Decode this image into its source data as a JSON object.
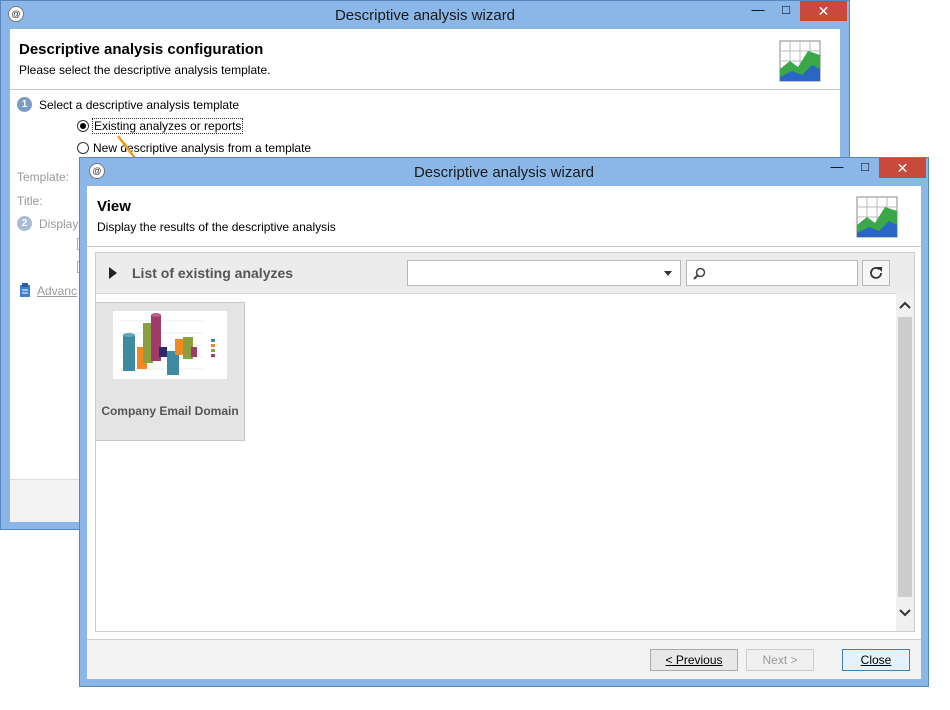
{
  "back_window": {
    "title": "Descriptive analysis wizard",
    "header_title": "Descriptive analysis configuration",
    "header_subtitle": "Please select the descriptive analysis template.",
    "step1_number": "1",
    "step1_label": "Select a descriptive analysis template",
    "option_existing": "Existing analyzes or reports",
    "option_new": "New descriptive analysis from a template",
    "template_label": "Template:",
    "title_label": "Title:",
    "step2_number": "2",
    "step2_label": "Display",
    "advanced_link": "Advanc"
  },
  "front_window": {
    "title": "Descriptive analysis wizard",
    "header_title": "View",
    "header_subtitle": "Display the results of the descriptive analysis",
    "list_title": "List of existing analyzes",
    "dropdown_value": "",
    "search_value": "",
    "items": [
      {
        "label": "Company Email Domain"
      }
    ],
    "prev_button": "< Previous",
    "next_button": "Next >",
    "close_button": "Close"
  },
  "controls": {
    "minimize": "—",
    "maximize": "□",
    "close": "✕"
  },
  "colors": {
    "titlebar": "#8ab6e8",
    "arrow": "#f39c1f",
    "close_button": "#c74a3c"
  }
}
